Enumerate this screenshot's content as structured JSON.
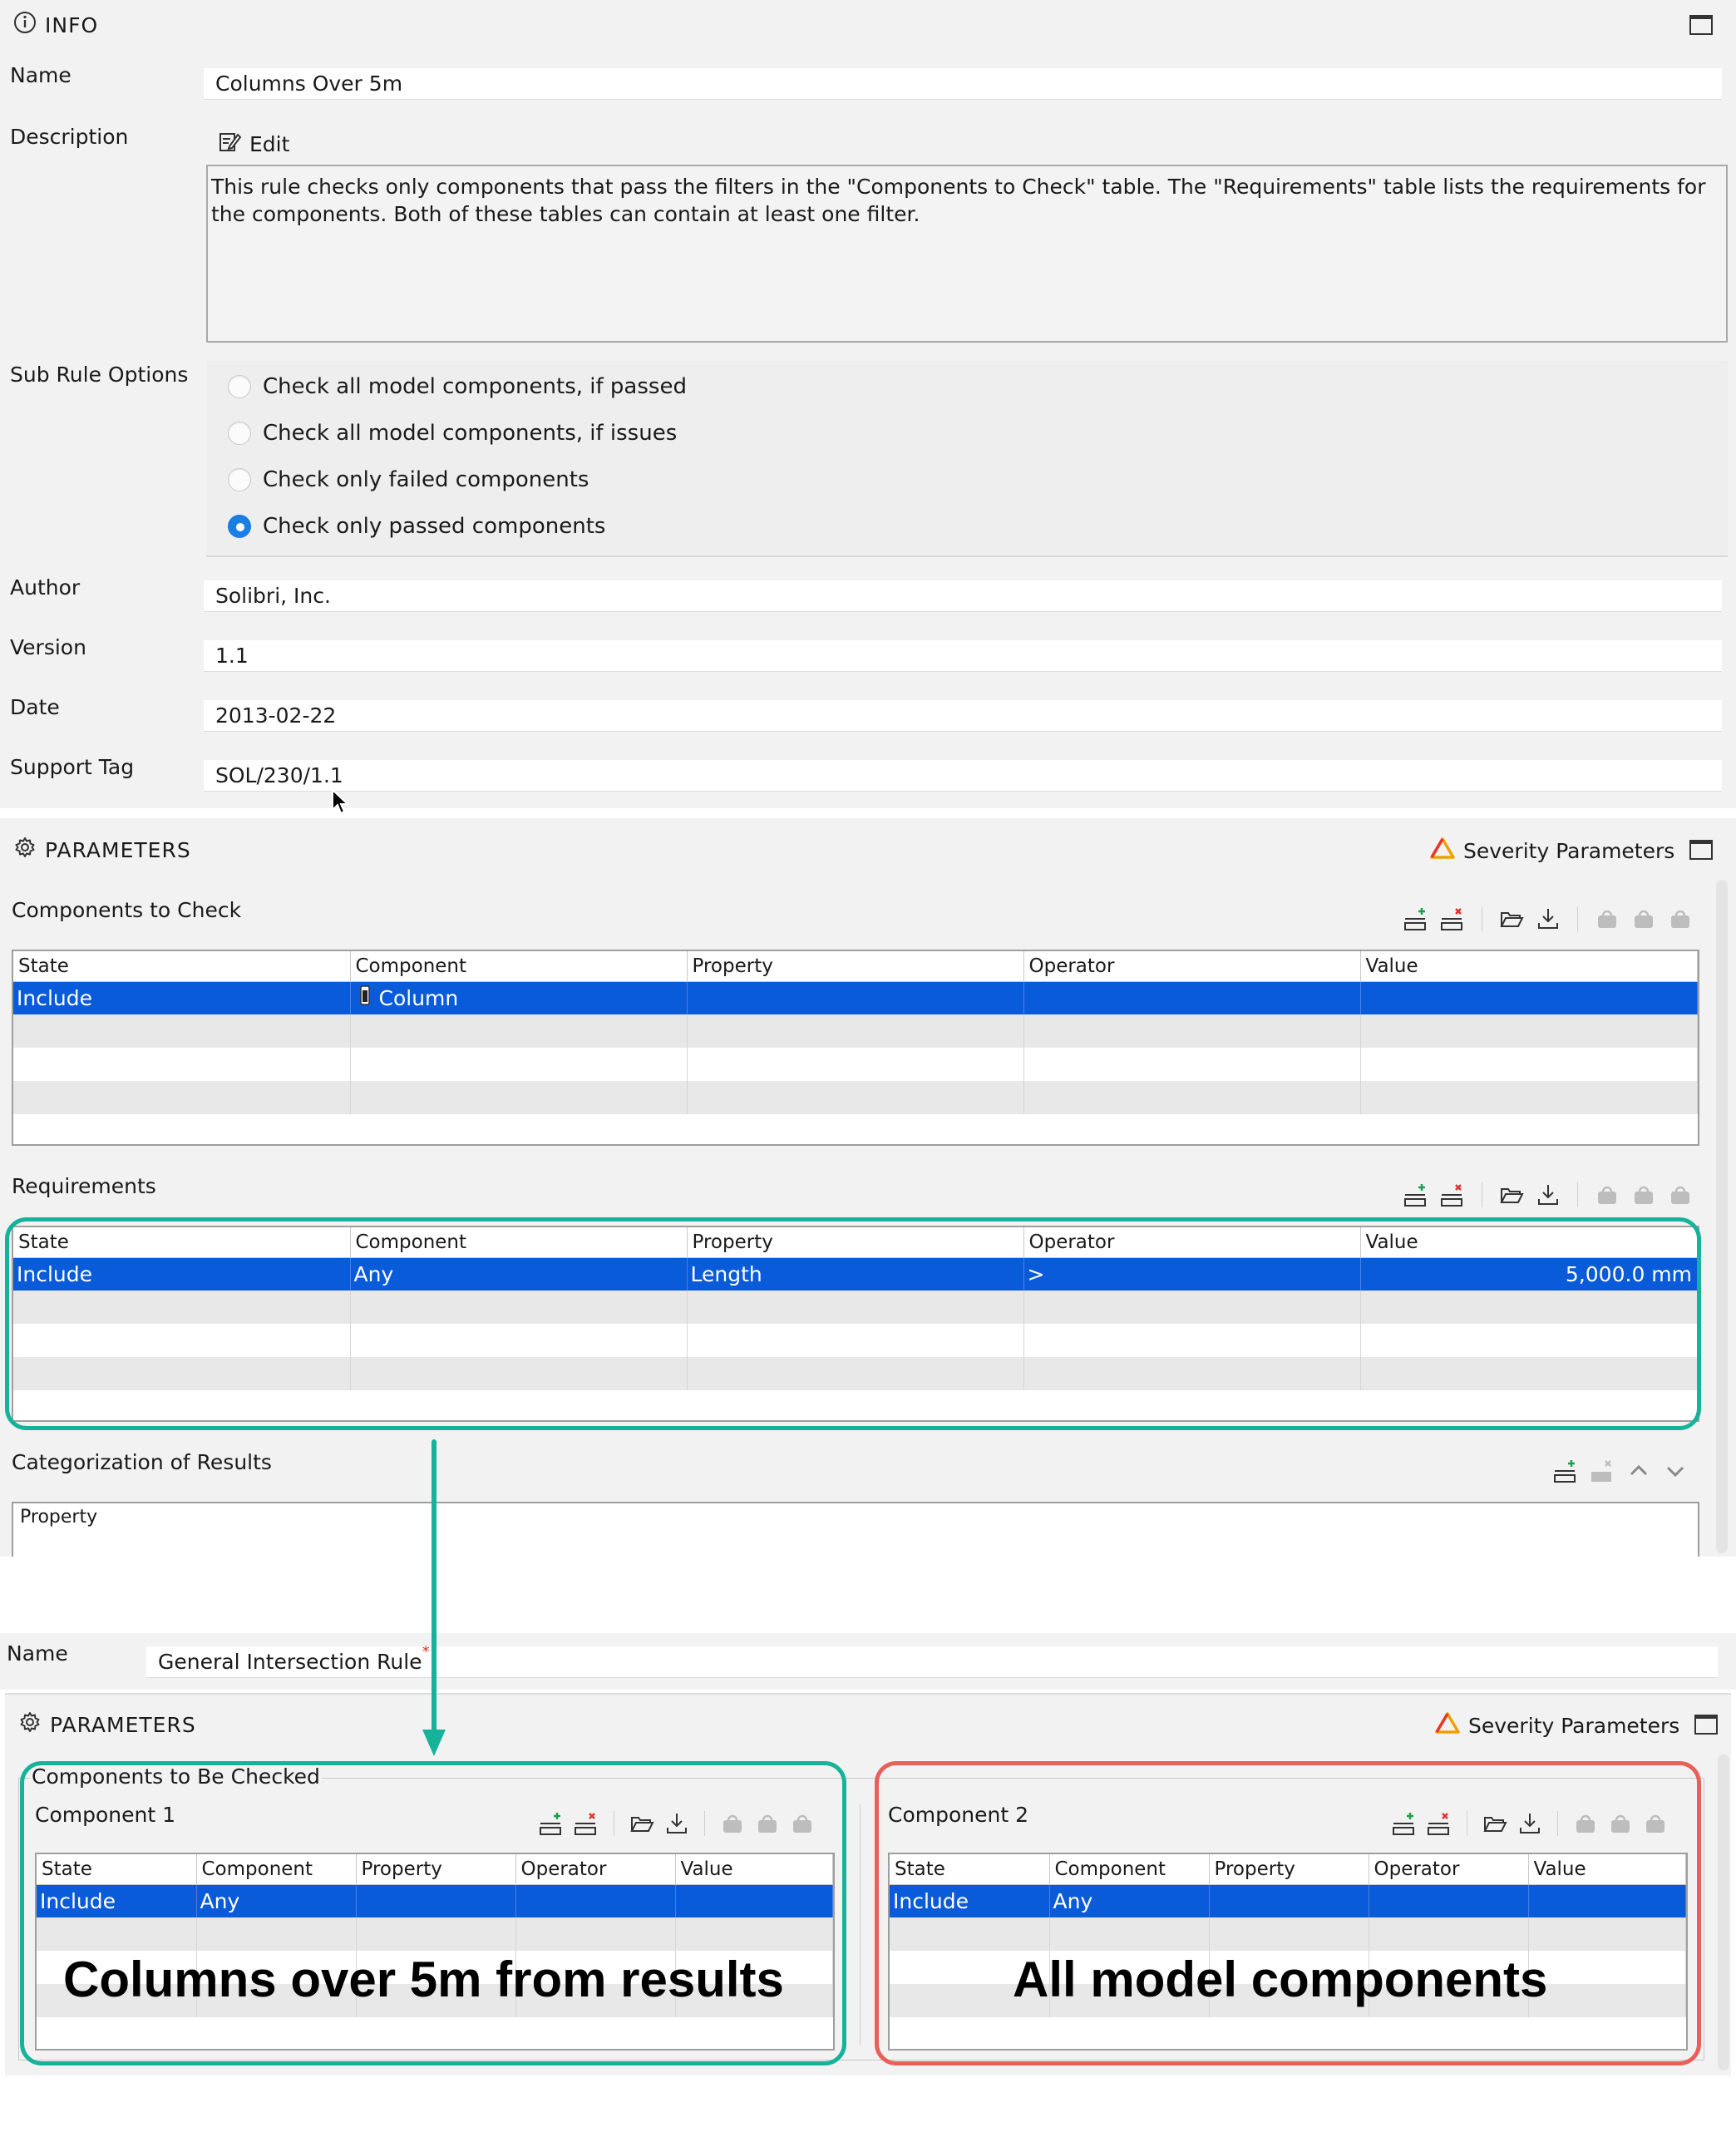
{
  "info": {
    "header": "INFO",
    "fields": {
      "name_label": "Name",
      "name_value": "Columns Over 5m",
      "description_label": "Description",
      "edit_label": "Edit",
      "description_text": "This rule checks only components that pass the filters in the \"Components to Check\" table. The \"Requirements\" table lists the requirements for the components. Both of these tables can contain at least one filter.",
      "sub_rule_label": "Sub Rule Options",
      "author_label": "Author",
      "author_value": "Solibri, Inc.",
      "version_label": "Version",
      "version_value": "1.1",
      "date_label": "Date",
      "date_value": "2013-02-22",
      "support_label": "Support Tag",
      "support_value": "SOL/230/1.1"
    },
    "sub_rule_options": [
      {
        "label": "Check all model components, if passed",
        "selected": false
      },
      {
        "label": "Check all model components, if issues",
        "selected": false
      },
      {
        "label": "Check only failed components",
        "selected": false
      },
      {
        "label": "Check only passed components",
        "selected": true
      }
    ]
  },
  "parameters": {
    "header": "PARAMETERS",
    "severity_label": "Severity Parameters",
    "components_to_check": {
      "title": "Components to Check",
      "columns": [
        "State",
        "Component",
        "Property",
        "Operator",
        "Value"
      ],
      "rows": [
        {
          "state": "Include",
          "component": "Column",
          "property": "",
          "operator": "",
          "value": ""
        }
      ]
    },
    "requirements": {
      "title": "Requirements",
      "columns": [
        "State",
        "Component",
        "Property",
        "Operator",
        "Value"
      ],
      "rows": [
        {
          "state": "Include",
          "component": "Any",
          "property": "Length",
          "operator": ">",
          "value": "5,000.0 mm"
        }
      ]
    },
    "categorization": {
      "title": "Categorization of Results",
      "columns": [
        "Property"
      ]
    }
  },
  "second_rule": {
    "name_label": "Name",
    "name_value": "General Intersection Rule",
    "header": "PARAMETERS",
    "severity_label": "Severity Parameters",
    "group_label": "Components to Be Checked",
    "component1": {
      "title": "Component 1",
      "columns": [
        "State",
        "Component",
        "Property",
        "Operator",
        "Value"
      ],
      "rows": [
        {
          "state": "Include",
          "component": "Any",
          "property": "",
          "operator": "",
          "value": ""
        }
      ]
    },
    "component2": {
      "title": "Component 2",
      "columns": [
        "State",
        "Component",
        "Property",
        "Operator",
        "Value"
      ],
      "rows": [
        {
          "state": "Include",
          "component": "Any",
          "property": "",
          "operator": "",
          "value": ""
        }
      ]
    }
  },
  "annotations": {
    "left_caption": "Columns over 5m from results",
    "right_caption": "All model components",
    "teal_color": "#16b29a",
    "red_color": "#e8605a"
  }
}
